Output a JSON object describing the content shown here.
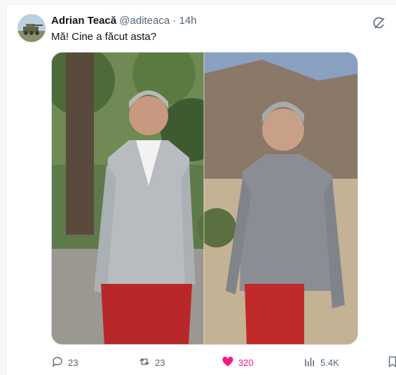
{
  "tweet": {
    "author_name": "Adrian Teacă",
    "author_handle": "@aditeaca",
    "separator": "·",
    "time": "14h",
    "text": "Mă! Cine a făcut asta?"
  },
  "actions": {
    "replies": "23",
    "retweets": "23",
    "likes": "320",
    "views": "5.4K"
  },
  "colors": {
    "like_active": "#f91880",
    "muted": "#536471"
  },
  "icons": [
    "grok-icon",
    "reply-icon",
    "retweet-icon",
    "like-icon",
    "views-icon",
    "bookmark-icon"
  ]
}
